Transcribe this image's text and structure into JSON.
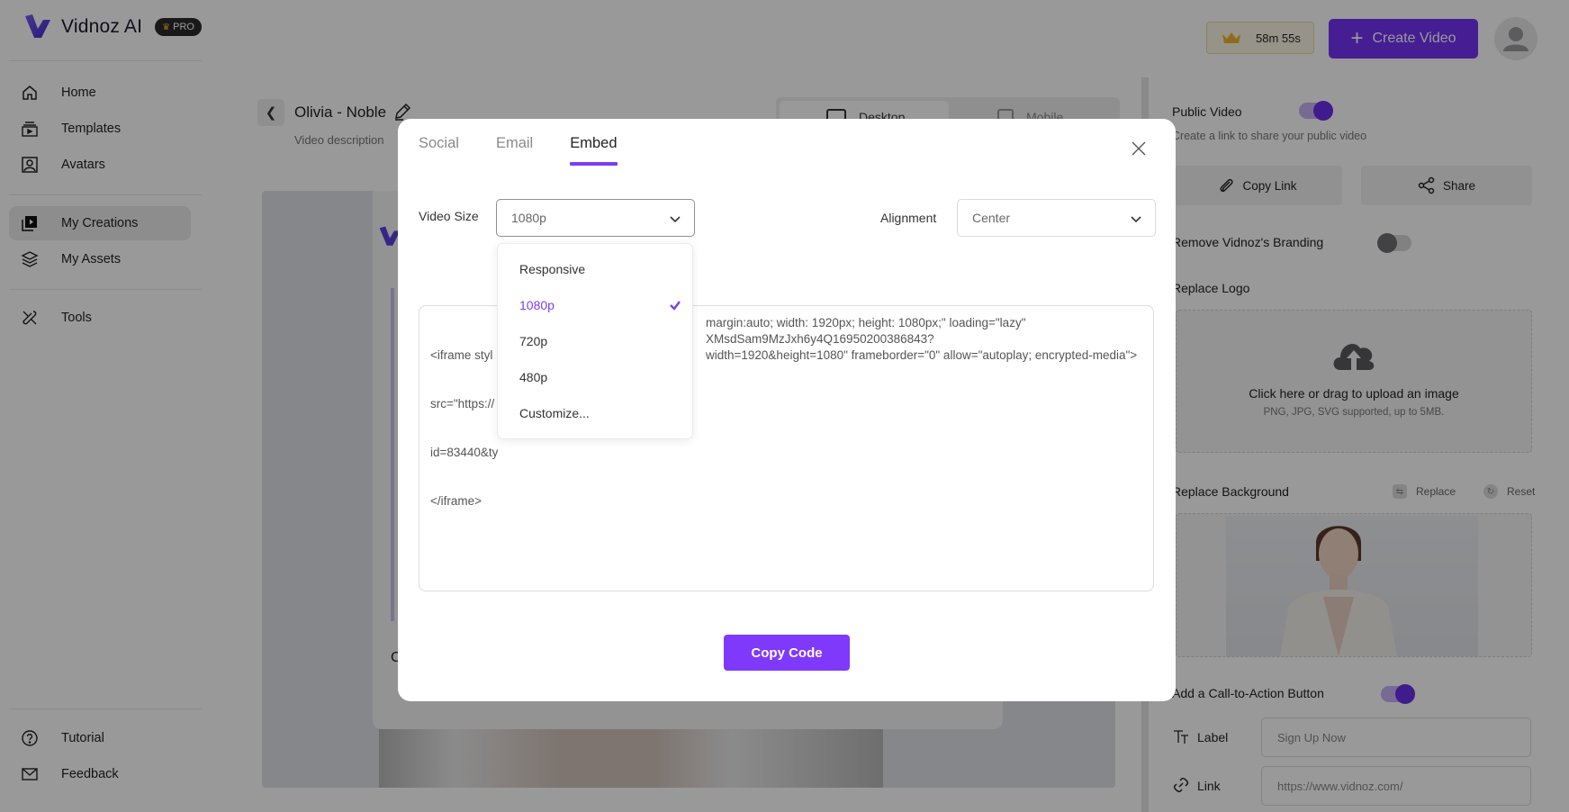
{
  "brand": {
    "name": "Vidnoz AI",
    "badge": "PRO",
    "accent_color": "#7433f5"
  },
  "sidebar": {
    "items": [
      {
        "label": "Home",
        "icon": "home-icon",
        "active": false
      },
      {
        "label": "Templates",
        "icon": "templates-icon",
        "active": false
      },
      {
        "label": "Avatars",
        "icon": "avatar-icon",
        "active": false
      },
      {
        "label": "My Creations",
        "icon": "video-library-icon",
        "active": true
      },
      {
        "label": "My Assets",
        "icon": "layers-icon",
        "active": false
      },
      {
        "label": "Tools",
        "icon": "tools-icon",
        "active": false
      }
    ],
    "footer_items": [
      {
        "label": "Tutorial",
        "icon": "help-icon"
      },
      {
        "label": "Feedback",
        "icon": "mail-icon"
      }
    ]
  },
  "topbar": {
    "timer": "58m 55s",
    "create_label": "Create Video"
  },
  "video": {
    "title": "Olivia - Noble",
    "description_placeholder": "Video description",
    "view_tabs": [
      "Desktop",
      "Mobile"
    ],
    "active_view": "Desktop",
    "preview_partial_text": "C"
  },
  "right_panel": {
    "public_video_label": "Public Video",
    "public_video_on": true,
    "public_video_sub": "Create a link to share your public video",
    "copy_link_label": "Copy Link",
    "share_label": "Share",
    "remove_branding_label": "Remove Vidnoz's Branding",
    "remove_branding_on": false,
    "replace_logo_label": "Replace Logo",
    "upload_title": "Click here or drag to upload an image",
    "upload_sub": "PNG, JPG, SVG supported, up to 5MB.",
    "replace_background_label": "Replace Background",
    "replace_label": "Replace",
    "reset_label": "Reset",
    "cta_label": "Add a Call-to-Action Button",
    "cta_on": true,
    "label_field_label": "Label",
    "label_field_value": "Sign Up Now",
    "link_field_label": "Link",
    "link_field_value": "https://www.vidnoz.com/"
  },
  "modal": {
    "tabs": [
      "Social",
      "Email",
      "Embed"
    ],
    "active_tab": "Embed",
    "video_size_label": "Video Size",
    "video_size_value": "1080p",
    "alignment_label": "Alignment",
    "alignment_value": "Center",
    "size_options": [
      "Responsive",
      "1080p",
      "720p",
      "480p",
      "Customize..."
    ],
    "selected_size": "1080p",
    "code_lines": [
      "<iframe styl",
      "src=\"https://",
      "id=83440&ty",
      "</iframe>"
    ],
    "code_lines_right": [
      "margin:auto; width: 1920px; height: 1080px;\" loading=\"lazy\"",
      "XMsdSam9MzJxh6y4Q16950200386843?",
      "width=1920&height=1080\" frameborder=\"0\" allow=\"autoplay; encrypted-media\">"
    ],
    "copy_label": "Copy Code"
  }
}
